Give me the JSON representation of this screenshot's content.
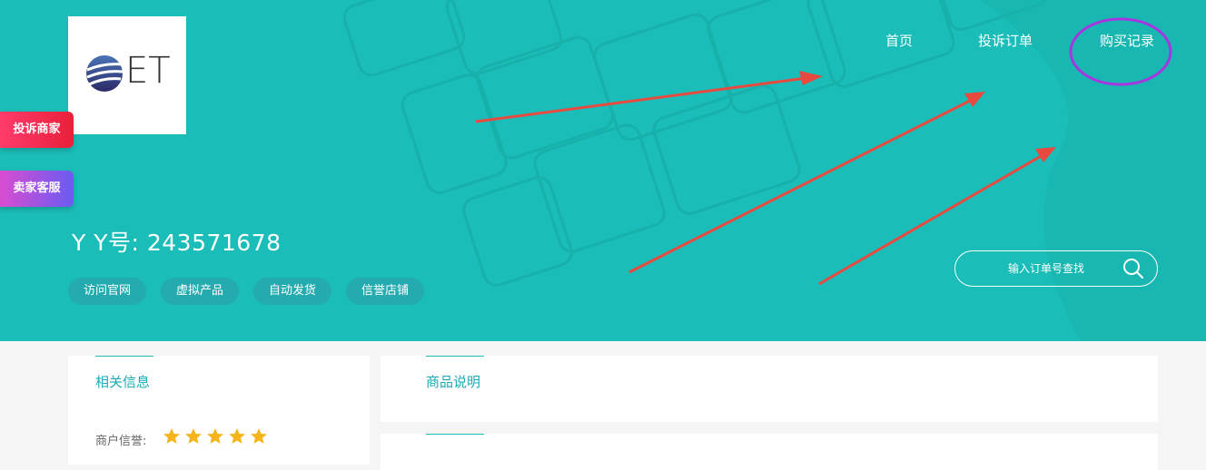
{
  "header": {
    "logo_text": "ET",
    "nav": {
      "home": "首页",
      "complaint_orders": "投诉订单",
      "purchase_records": "购买记录"
    },
    "yy_label": "Y Y号: 243571678",
    "tags": [
      "访问官网",
      "虚拟产品",
      "自动发货",
      "信誉店铺"
    ],
    "search": {
      "placeholder": "输入订单号查找",
      "icon": "search-icon"
    }
  },
  "side_buttons": {
    "complain_merchant": "投诉商家",
    "seller_service": "卖家客服"
  },
  "sections": {
    "related_info": {
      "title": "相关信息",
      "rating_label": "商户信誉:",
      "rating_stars": 5,
      "rating_max": 5
    },
    "product_desc": {
      "title": "商品说明"
    }
  },
  "colors": {
    "hero_bg": "#1bbdb8",
    "accent": "#1baab5",
    "star": "#f5b51b",
    "annotation_arrow": "#e94a3f",
    "annotation_circle": "#a636e0"
  }
}
